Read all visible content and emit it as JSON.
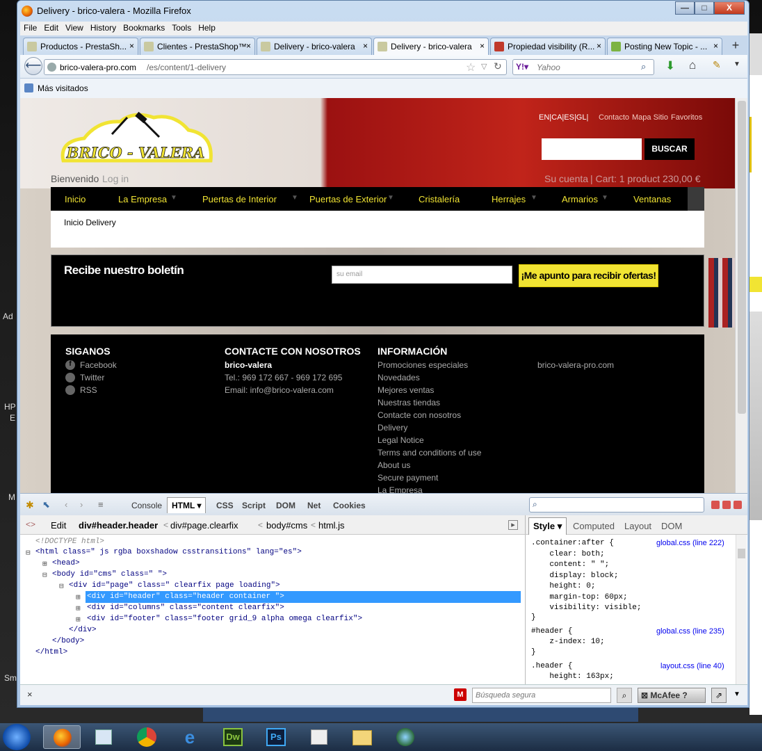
{
  "desktop": {
    "labels": [
      "Ad",
      "HP",
      "E",
      "M",
      "Sm"
    ]
  },
  "window": {
    "title": "Delivery - brico-valera - Mozilla Firefox",
    "min": "—",
    "max": "□",
    "close": "X"
  },
  "menubar": [
    "File",
    "Edit",
    "View",
    "History",
    "Bookmarks",
    "Tools",
    "Help"
  ],
  "tabs": [
    {
      "label": "Productos - PrestaSh...",
      "close": "×"
    },
    {
      "label": "Clientes - PrestaShop™",
      "close": "×"
    },
    {
      "label": "Delivery - brico-valera",
      "close": "×"
    },
    {
      "label": "Delivery - brico-valera",
      "close": "×",
      "active": true
    },
    {
      "label": "Propiedad visibility (R...",
      "close": "×"
    },
    {
      "label": "Posting New Topic - ...",
      "close": "×"
    }
  ],
  "newtab": "+",
  "nav": {
    "url_host": "brico-valera-pro.com",
    "url_path": "/es/content/1-delivery",
    "search_engine": "Yahoo"
  },
  "bookmarks": {
    "item": "Más visitados"
  },
  "site": {
    "langs": "EN|CA|ES|GL|",
    "top_links": [
      "Contacto",
      "Mapa Sitio",
      "Favoritos"
    ],
    "search_button": "BUSCAR",
    "logo_text": "BRICO - VALERA",
    "welcome": "Bienvenido",
    "login": "Log in",
    "account": "Su cuenta",
    "cart": "Cart: 1 product 230,00 €",
    "menu": [
      "Inicio",
      "La Empresa",
      "Puertas de Interior",
      "Puertas de Exterior",
      "Cristalería",
      "Herrajes",
      "Armarios",
      "Ventanas"
    ],
    "breadcrumb": "Inicio Delivery",
    "newsletter": {
      "title": "Recibe nuestro boletín",
      "placeholder": "su email",
      "button": "¡Me apunto para recibir ofertas!"
    },
    "footer": {
      "follow": {
        "title": "SIGANOS",
        "items": [
          "Facebook",
          "Twitter",
          "RSS"
        ]
      },
      "contact": {
        "title": "CONTACTE CON NOSOTROS",
        "name": "brico-valera",
        "tel": "Tel.: 969 172 667 - 969 172 695",
        "email": "Email: info@brico-valera.com"
      },
      "info": {
        "title": "INFORMACIÓN",
        "items": [
          "Promociones especiales",
          "Novedades",
          "Mejores ventas",
          "Nuestras tiendas",
          "Contacte con nosotros",
          "Delivery",
          "Legal Notice",
          "Terms and conditions of use",
          "About us",
          "Secure payment",
          "La Empresa"
        ]
      },
      "site": "brico-valera-pro.com"
    }
  },
  "firebug": {
    "tabs": [
      "Console",
      "HTML",
      "CSS",
      "Script",
      "DOM",
      "Net",
      "Cookies"
    ],
    "edit": "Edit",
    "crumbs": [
      "div#header.header",
      "div#page.clearfix",
      "body#cms",
      "html.js"
    ],
    "side_tabs": [
      "Style",
      "Computed",
      "Layout",
      "DOM"
    ],
    "html_lines": [
      "<!DOCTYPE html>",
      "<html class=\" js rgba boxshadow csstransitions\" lang=\"es\">",
      "<head>",
      "<body id=\"cms\" class=\" \">",
      "<div id=\"page\" class=\" clearfix page loading\">",
      "<div id=\"header\" class=\"header container \">",
      "<div id=\"columns\" class=\"content clearfix\">",
      "<div id=\"footer\" class=\"footer grid_9 alpha omega clearfix\">",
      "</div>",
      "</body>",
      "</html>"
    ],
    "css": [
      {
        "text": ".container:after {",
        "src": "global.css (line 222)"
      },
      {
        "text": "    clear: both;"
      },
      {
        "text": "    content: \" \";"
      },
      {
        "text": "    display: block;"
      },
      {
        "text": "    height: 0;"
      },
      {
        "text": "    margin-top: 60px;"
      },
      {
        "text": "    visibility: visible;"
      },
      {
        "text": "}"
      },
      {
        "text": "#header {",
        "src": "global.css (line 235)"
      },
      {
        "text": "    z-index: 10;"
      },
      {
        "text": "}"
      },
      {
        "text": ".header {",
        "src": "layout.css (line 40)"
      },
      {
        "text": "    height: 163px;"
      }
    ]
  },
  "status": {
    "secure_search": "Búsqueda segura",
    "mcafee": "McAfee",
    "close": "×"
  },
  "colors": {
    "accent": "#f1e433",
    "nav_bg": "#000000",
    "selected": "#3399ff"
  }
}
